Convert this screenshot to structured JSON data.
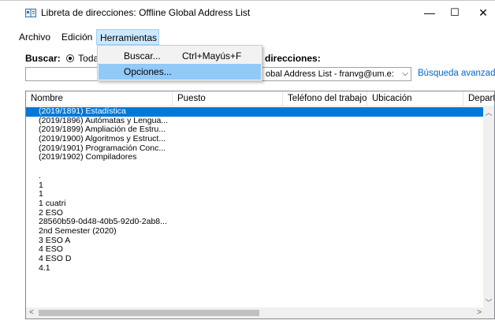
{
  "window": {
    "title": "Libreta de direcciones: Offline Global Address List",
    "minimize": "—",
    "maximize": "☐",
    "close": "✕"
  },
  "menubar": {
    "items": [
      "Archivo",
      "Edición",
      "Herramientas"
    ],
    "active": "Herramientas"
  },
  "tools_menu": {
    "items": [
      {
        "label": "Buscar...",
        "shortcut": "Ctrl+Mayús+F",
        "highlighted": false
      },
      {
        "label": "Opciones...",
        "shortcut": "",
        "highlighted": true
      }
    ]
  },
  "search": {
    "label": "Buscar:",
    "option": "Todas",
    "name_value": ""
  },
  "address_book": {
    "label": "direcciones:",
    "selected": "obal Address List - franvg@um.e:",
    "advanced_link": "Búsqueda avanzada"
  },
  "table": {
    "columns": [
      "Nombre",
      "Puesto",
      "Teléfono del trabajo",
      "Ubicación",
      "Departa"
    ],
    "rows": [
      "(2019/1891) Estadística",
      "(2019/1896) Autómatas y Lengua...",
      "(2019/1899) Ampliación de Estru...",
      "(2019/1900) Algoritmos y Estruct...",
      "(2019/1901) Programación Conc...",
      "(2019/1902) Compiladores",
      "",
      ".",
      "1",
      "1",
      "1 cuatri",
      "2 ESO",
      "28560b59-0d48-40b5-92d0-2ab8...",
      "2nd Semester (2020)",
      "3 ESO A",
      "4 ESO",
      "4 ESO D",
      "4.1"
    ],
    "selected_index": 0
  },
  "colors": {
    "selection": "#0078d7",
    "menu_highlight": "#91c9f7",
    "link": "#0066cc"
  }
}
